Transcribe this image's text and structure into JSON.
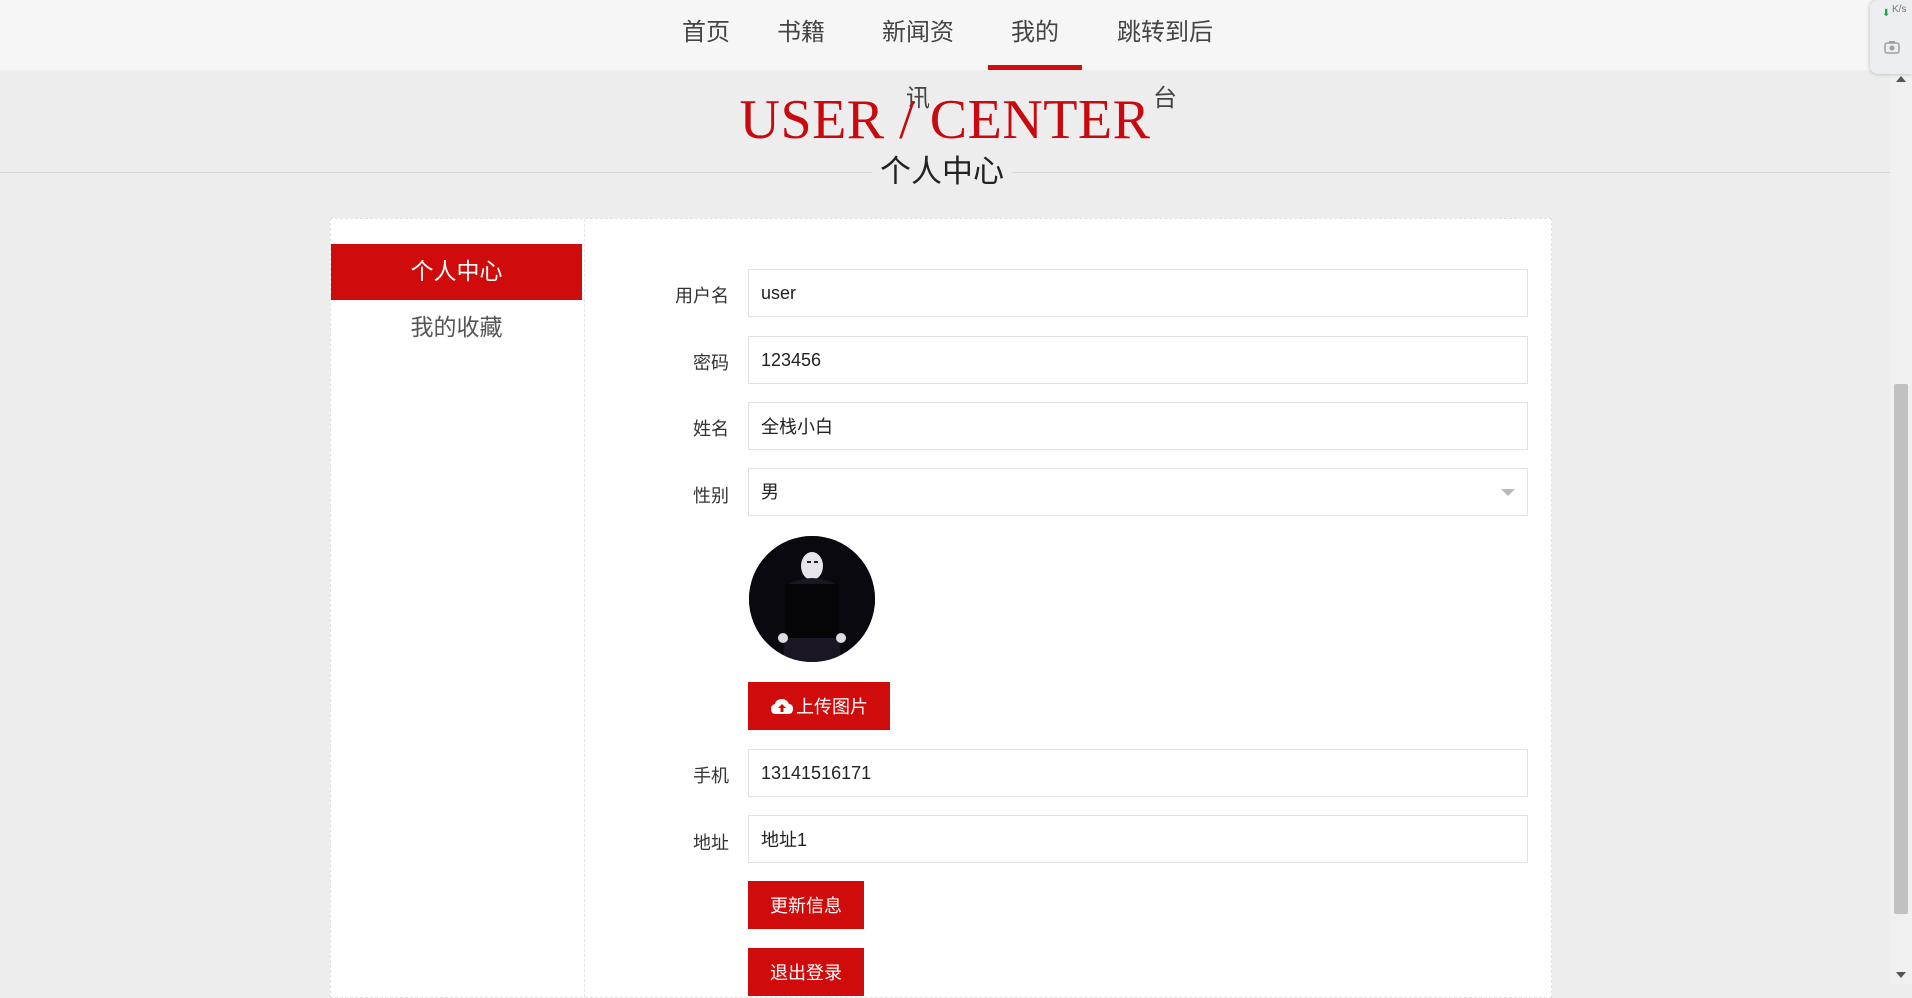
{
  "nav": {
    "items": [
      {
        "label": "首页"
      },
      {
        "label": "书籍"
      },
      {
        "label": "新闻资讯"
      },
      {
        "label": "我的",
        "active": true
      },
      {
        "label": "跳转到后台"
      }
    ]
  },
  "hero": {
    "title": "USER / CENTER",
    "subtitle": "个人中心"
  },
  "sidebar": {
    "items": [
      {
        "label": "个人中心",
        "active": true
      },
      {
        "label": "我的收藏"
      }
    ]
  },
  "form": {
    "username": {
      "label": "用户名",
      "value": "user"
    },
    "password": {
      "label": "密码",
      "value": "123456"
    },
    "name": {
      "label": "姓名",
      "value": "全栈小白"
    },
    "gender": {
      "label": "性别",
      "value": "男"
    },
    "phone": {
      "label": "手机",
      "value": "13141516171"
    },
    "address": {
      "label": "地址",
      "value": "地址1"
    },
    "upload_label": "上传图片",
    "update_label": "更新信息",
    "logout_label": "退出登录"
  },
  "widget": {
    "speed": "K/s"
  },
  "colors": {
    "accent": "#cf0b0b",
    "title": "#c8090f"
  }
}
